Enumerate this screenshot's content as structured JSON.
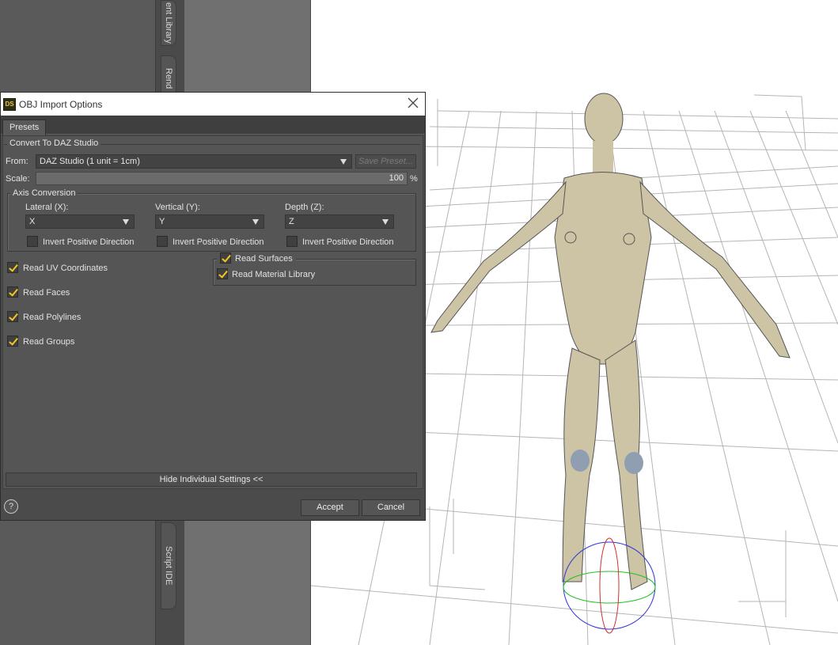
{
  "background": {
    "tabs": [
      "ent Library",
      "Rend",
      "Script IDE"
    ]
  },
  "dialog": {
    "title": "OBJ Import Options",
    "app_icon_text": "DS",
    "presets_tab": "Presets",
    "convert_group": "Convert To DAZ Studio",
    "from_label": "From:",
    "from_value": "DAZ Studio (1 unit = 1cm)",
    "save_preset": "Save Preset...",
    "scale_label": "Scale:",
    "scale_value": "100",
    "scale_unit": "%",
    "axis_group": "Axis Conversion",
    "axes": [
      {
        "label": "Lateral (X):",
        "value": "X",
        "invert_label": "Invert Positive Direction",
        "invert_checked": false
      },
      {
        "label": "Vertical (Y):",
        "value": "Y",
        "invert_label": "Invert Positive Direction",
        "invert_checked": false
      },
      {
        "label": "Depth (Z):",
        "value": "Z",
        "invert_label": "Invert Positive Direction",
        "invert_checked": false
      }
    ],
    "left_options": [
      {
        "label": "Read UV Coordinates",
        "checked": true
      },
      {
        "label": "Read Faces",
        "checked": true
      },
      {
        "label": "Read Polylines",
        "checked": true
      },
      {
        "label": "Read Groups",
        "checked": true
      }
    ],
    "read_surfaces": {
      "label": "Read Surfaces",
      "checked": true
    },
    "read_material_library": {
      "label": "Read Material Library",
      "checked": true
    },
    "hide_settings": "Hide Individual Settings <<",
    "help": "?",
    "accept": "Accept",
    "cancel": "Cancel"
  },
  "colors": {
    "check_accent": "#f2c81e",
    "dialog_bg": "#4b4b4b",
    "panel_bg": "#555555"
  }
}
